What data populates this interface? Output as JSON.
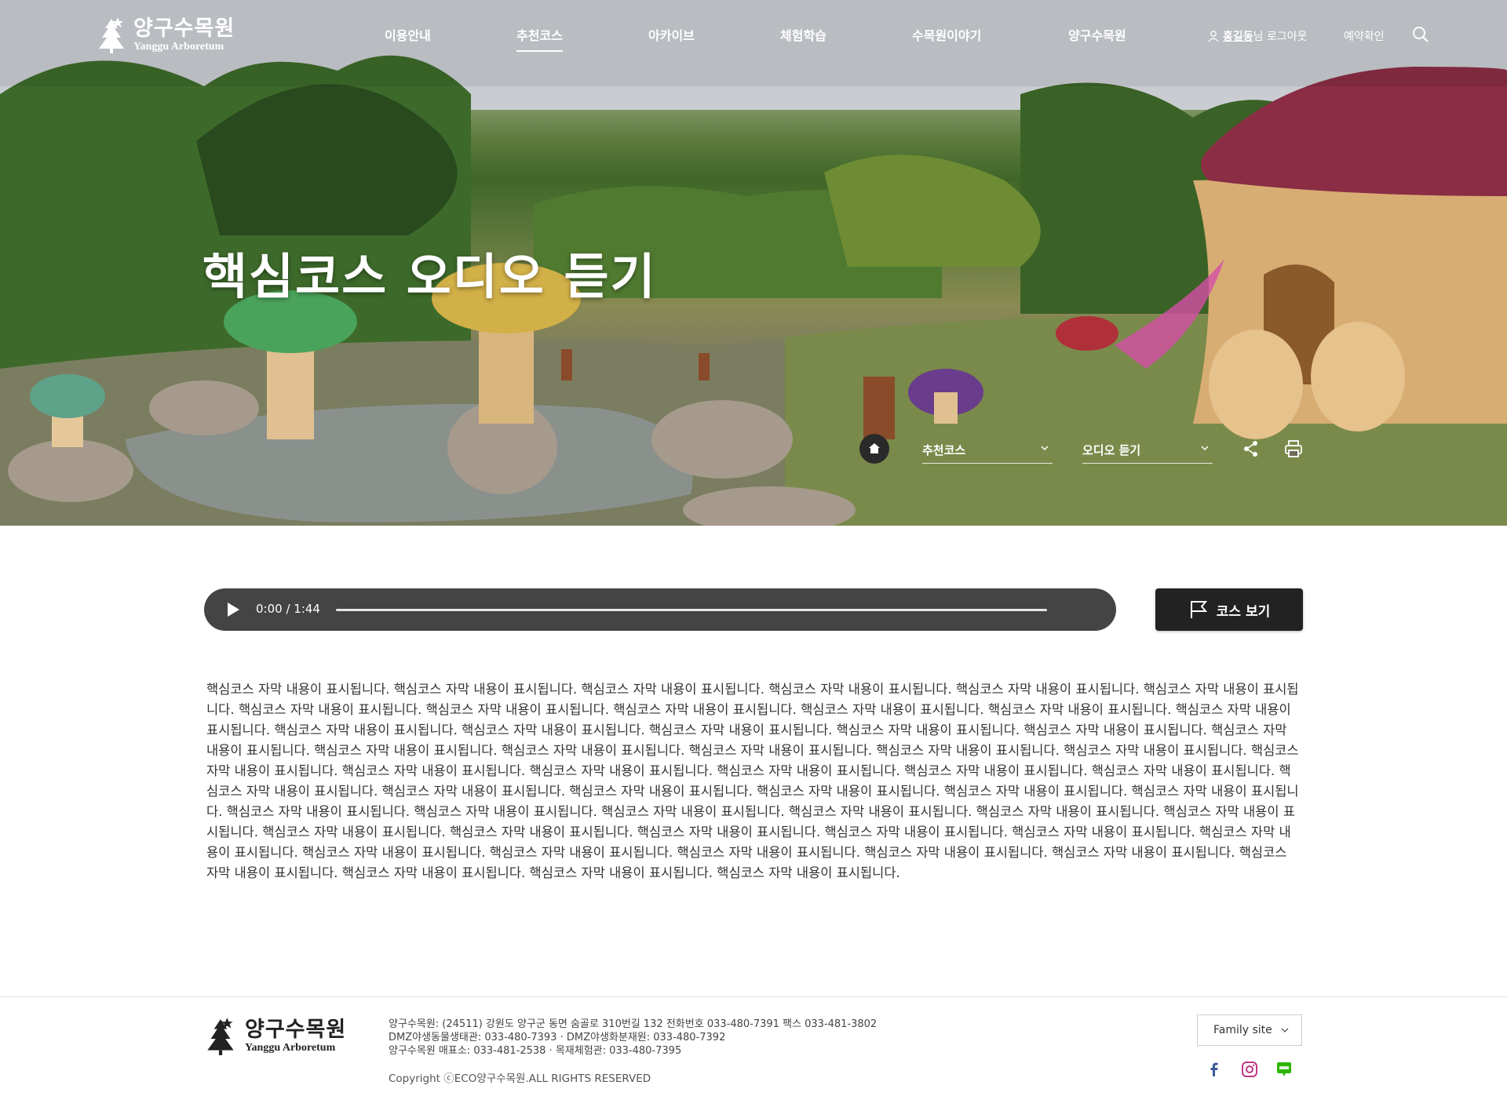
{
  "brand": {
    "name_ko": "양구수목원",
    "name_en": "Yanggu Arboretum"
  },
  "nav": {
    "items": [
      {
        "label": "이용안내"
      },
      {
        "label": "추천코스",
        "active": true
      },
      {
        "label": "아카이브"
      },
      {
        "label": "체험학습"
      },
      {
        "label": "수목원이야기"
      },
      {
        "label": "양구수목원"
      }
    ]
  },
  "util": {
    "user_name": "홍길동",
    "user_suffix": "님 로그아웃",
    "reserve": "예약확인"
  },
  "hero": {
    "title": "핵심코스 오디오 듣기"
  },
  "location": {
    "select1": "추천코스",
    "select2": "오디오 듣기"
  },
  "player": {
    "time": "0:00 / 1:44",
    "progress": 0
  },
  "course_button": {
    "label": "코스 보기"
  },
  "subtitle": {
    "text": "핵심코스 자막 내용이 표시됩니다. 핵심코스 자막 내용이 표시됩니다. 핵심코스 자막 내용이 표시됩니다. 핵심코스 자막 내용이 표시됩니다. 핵심코스 자막 내용이 표시됩니다. 핵심코스 자막 내용이 표시됩니다.  핵심코스 자막 내용이 표시됩니다. 핵심코스 자막 내용이 표시됩니다. 핵심코스 자막 내용이 표시됩니다. 핵심코스 자막 내용이 표시됩니다. 핵심코스 자막 내용이 표시됩니다. 핵심코스 자막 내용이 표시됩니다. 핵심코스 자막 내용이 표시됩니다.  핵심코스 자막 내용이 표시됩니다. 핵심코스 자막 내용이 표시됩니다. 핵심코스 자막 내용이 표시됩니다. 핵심코스 자막 내용이 표시됩니다. 핵심코스 자막 내용이 표시됩니다. 핵심코스 자막 내용이 표시됩니다.  핵심코스 자막 내용이 표시됩니다. 핵심코스 자막 내용이 표시됩니다. 핵심코스 자막 내용이 표시됩니다. 핵심코스 자막 내용이 표시됩니다. 핵심코스 자막 내용이 표시됩니다. 핵심코스 자막 내용이 표시됩니다. 핵심코스 자막 내용이 표시됩니다.  핵심코스 자막 내용이 표시됩니다. 핵심코스 자막 내용이 표시됩니다. 핵심코스 자막 내용이 표시됩니다. 핵심코스 자막 내용이 표시됩니다. 핵심코스 자막 내용이 표시됩니다. 핵심코스 자막 내용이 표시됩니다. 핵심코스 자막 내용이 표시됩니다.  핵심코스 자막 내용이 표시됩니다. 핵심코스 자막 내용이 표시됩니다. 핵심코스 자막 내용이 표시됩니다. 핵심코스 자막 내용이 표시됩니다. 핵심코스 자막 내용이 표시됩니다. 핵심코스 자막 내용이 표시됩니다. 핵심코스 자막 내용이 표시됩니다.  핵심코스 자막 내용이 표시됩니다. 핵심코스 자막 내용이 표시됩니다. 핵심코스 자막 내용이 표시됩니다. 핵심코스 자막 내용이 표시됩니다. 핵심코스 자막 내용이 표시됩니다. 핵심코스 자막 내용이 표시됩니다. 핵심코스 자막 내용이 표시됩니다. 핵심코스 자막 내용이 표시됩니다.  핵심코스 자막 내용이 표시됩니다. 핵심코스 자막 내용이 표시됩니다. 핵심코스 자막 내용이 표시됩니다. 핵심코스 자막 내용이 표시됩니다. 핵심코스 자막 내용이 표시됩니다. 핵심코스 자막 내용이 표시됩니다. 핵심코스 자막 내용이 표시됩니다. 핵심코스 자막 내용이 표시됩니다."
  },
  "footer": {
    "info_lines": [
      "양구수목원: (24511) 강원도 양구군 동면 숨골로 310번길 132 전화번호 033-480-7391 팩스 033-481-3802",
      "DMZ야생동물생태관: 033-480-7393 · DMZ야생화분재원: 033-480-7392",
      "양구수목원 매표소: 033-481-2538 · 목재체험관: 033-480-7395"
    ],
    "copyright": "Copyright ⓒECO양구수목원.ALL RIGHTS RESERVED",
    "family_site": "Family site",
    "sns": [
      "facebook-icon",
      "instagram-icon",
      "blog-icon"
    ]
  },
  "colors": {
    "player_bg": "#444444",
    "button_bg": "#222222",
    "facebook": "#3b5998",
    "instagram": "#c13584",
    "blog": "#2db400"
  }
}
